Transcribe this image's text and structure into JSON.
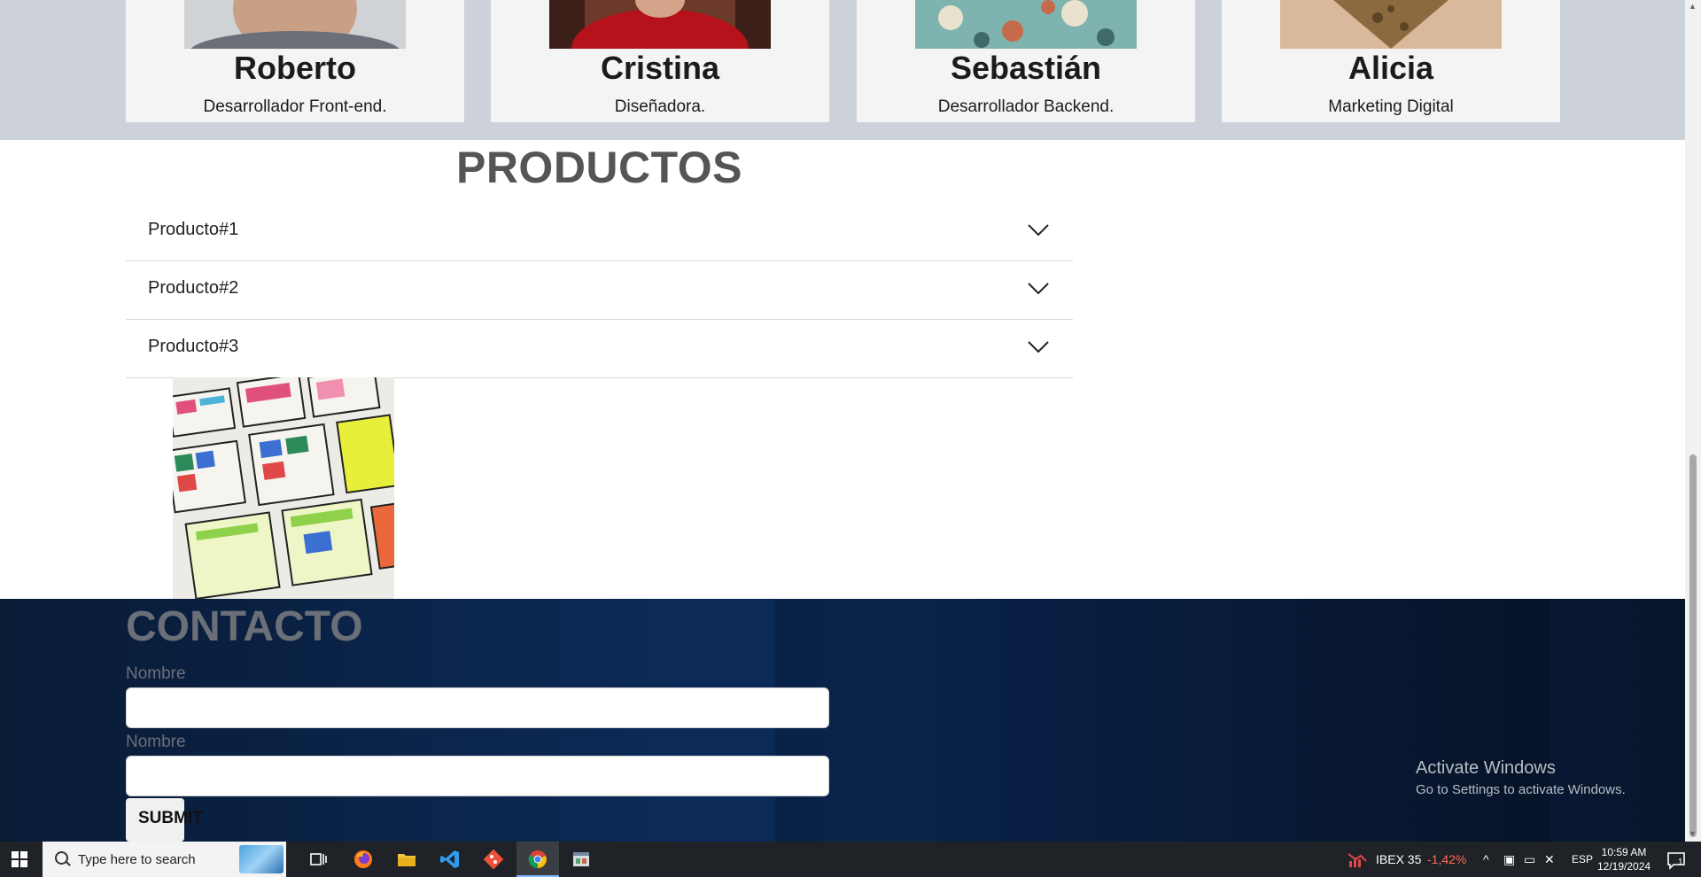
{
  "team": [
    {
      "name": "Roberto",
      "role": "Desarrollador Front-end."
    },
    {
      "name": "Cristina",
      "role": "Diseñadora."
    },
    {
      "name": "Sebastián",
      "role": "Desarrollador Backend."
    },
    {
      "name": "Alicia",
      "role": "Marketing Digital"
    }
  ],
  "productos": {
    "title": "PRODUCTOS",
    "items": [
      "Producto#1",
      "Producto#2",
      "Producto#3"
    ]
  },
  "contacto": {
    "title": "CONTACTO",
    "field1_label": "Nombre",
    "field2_label": "Nombre",
    "submit_label": "SUBMIT"
  },
  "watermark": {
    "line1": "Activate Windows",
    "line2": "Go to Settings to activate Windows."
  },
  "taskbar": {
    "search_placeholder": "Type here to search",
    "ticker_name": "IBEX 35",
    "ticker_change": "-1,42%",
    "language": "ESP",
    "time": "10:59 AM",
    "date": "12/19/2024",
    "notification_count": "1"
  },
  "colors": {
    "team_bg": "#cdd2da",
    "card_bg": "#f4f4f5",
    "contact_bg": "#0b2a57",
    "ticker_negative": "#ff6b5a"
  }
}
